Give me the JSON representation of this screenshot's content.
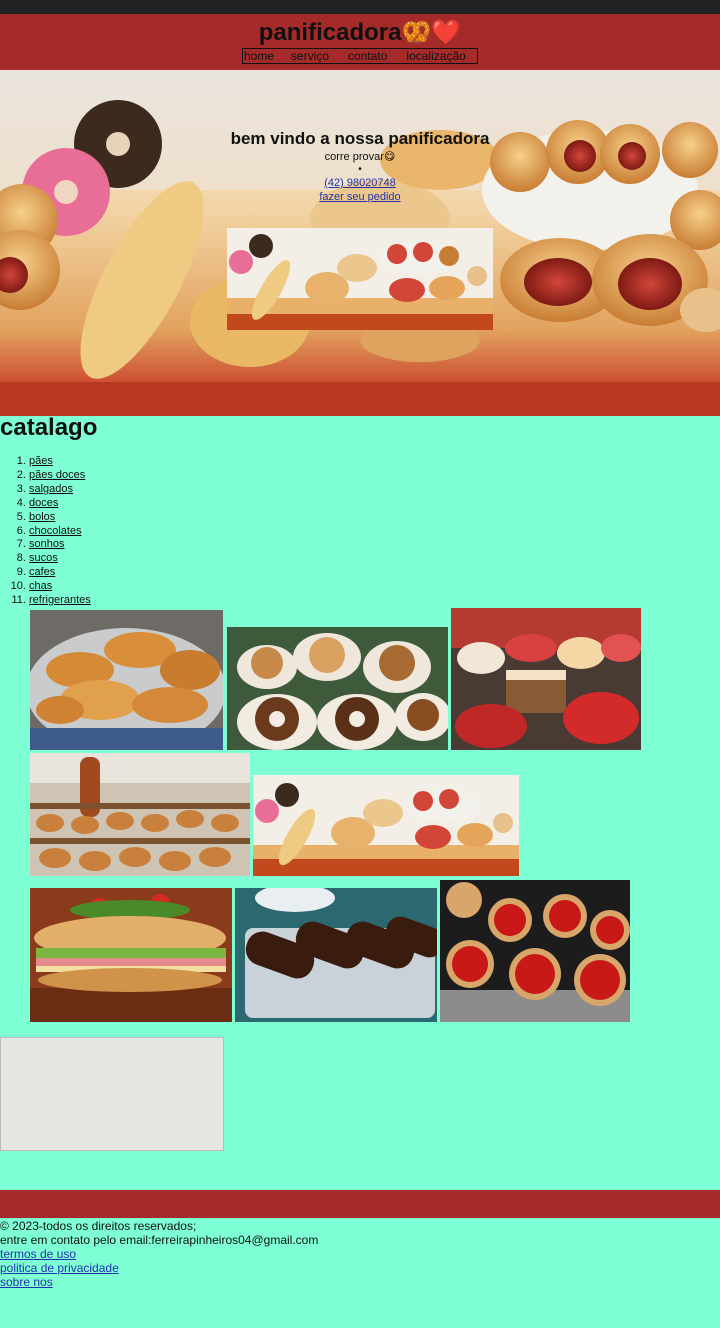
{
  "header": {
    "title": "panificadora🥨❤️",
    "nav": [
      "home",
      "serviço",
      "contato",
      "localização"
    ]
  },
  "hero": {
    "title": "bem vindo a nossa panificadora",
    "subtitle": "corre provar😋",
    "bullet": "•",
    "phone": "(42) 98020748",
    "order_link": "fazer seu pedido"
  },
  "catalog": {
    "title": "catalago",
    "items": [
      "pães",
      "pães doces",
      "salgados",
      "doces",
      "bolos",
      "chocolates",
      "sonhos",
      "sucos",
      "cafes",
      "chas",
      "refrigerantes"
    ]
  },
  "footer": {
    "copyright": "© 2023-todos os direitos reservados;",
    "contact": "entre em contato pelo email:ferreirapinheiros04@gmail.com",
    "links": [
      "termos de uso",
      "politica de privacidade",
      "sobre nos"
    ]
  },
  "colors": {
    "background": "#7fffd4",
    "header": "#a52a2a",
    "topbar": "#222222"
  }
}
